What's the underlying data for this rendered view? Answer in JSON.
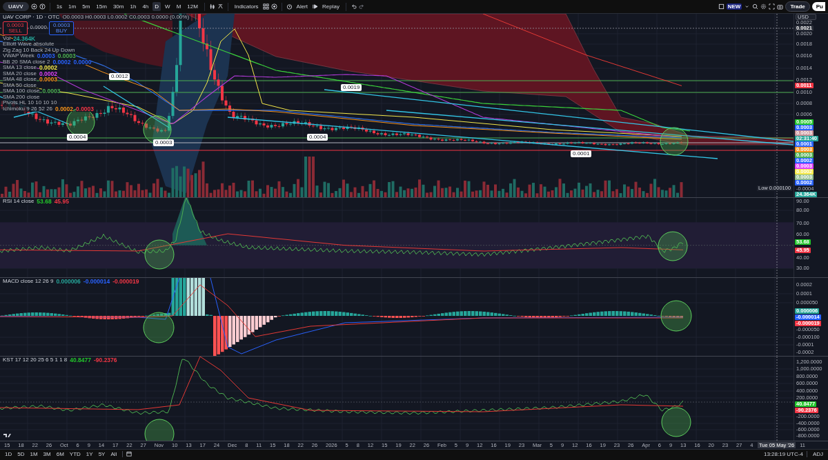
{
  "toolbar": {
    "symbol": "UAVV",
    "intervals": [
      {
        "label": "1s",
        "selected": false
      },
      {
        "label": "1m",
        "selected": false
      },
      {
        "label": "5m",
        "selected": false
      },
      {
        "label": "15m",
        "selected": false
      },
      {
        "label": "30m",
        "selected": false
      },
      {
        "label": "1h",
        "selected": false
      },
      {
        "label": "4h",
        "selected": false
      },
      {
        "label": "D",
        "selected": true
      },
      {
        "label": "W",
        "selected": false
      },
      {
        "label": "M",
        "selected": false
      },
      {
        "label": "12M",
        "selected": false
      }
    ],
    "indicators": "Indicators",
    "alert": "Alert",
    "replay": "Replay",
    "new_badge": "NEW",
    "trade": "Trade",
    "publish": "Pu"
  },
  "panes": [
    {
      "kind": "price",
      "title": "UAV CORP · 1D · OTC",
      "ohlc": "O0.0003 H0.0003 L0.0002 C0.0003 0.0000 (0.00%)",
      "sell": {
        "price": "0.0003",
        "label": "SELL"
      },
      "spread": "0.0000",
      "buy": {
        "price": "0.0003",
        "label": "BUY"
      },
      "legend": [
        {
          "label": "Vol",
          "values": [
            {
              "text": "24.364K",
              "color": "#26a69a"
            }
          ]
        },
        {
          "label": "Elliott Wave absolute"
        },
        {
          "label": "Zig Zag 10 Back 24 Up Down"
        },
        {
          "label": "VWAP Week",
          "values": [
            {
              "text": "0.0003",
              "color": "#2962ff"
            },
            {
              "text": "0.0003",
              "color": "#4caf50"
            }
          ]
        },
        {
          "label": "BB 20 SMA close 2",
          "values": [
            {
              "text": "0.0002",
              "color": "#2962ff"
            },
            {
              "text": "0.0000",
              "color": "#2962ff"
            }
          ]
        },
        {
          "label": "SMA 13 close",
          "values": [
            {
              "text": "0.0002",
              "color": "#f5e94b"
            }
          ]
        },
        {
          "label": "SMA 20 close",
          "values": [
            {
              "text": "0.0002",
              "color": "#e040fb"
            }
          ]
        },
        {
          "label": "SMA 48 close",
          "values": [
            {
              "text": "0.0003",
              "color": "#f7931a"
            }
          ]
        },
        {
          "label": "SMA 50 close"
        },
        {
          "label": "SMA 100 close",
          "values": [
            {
              "text": "0.0003",
              "color": "#4caf50"
            }
          ]
        },
        {
          "label": "SMA 200 close"
        },
        {
          "label": "Pivots HL 10 10 10 10"
        },
        {
          "label": "Ichimoku 9 26 52 26",
          "values": [
            {
              "text": "0.0002",
              "color": "#f7931a"
            },
            {
              "text": "0.0003",
              "color": "#f23645"
            }
          ]
        }
      ],
      "callouts": [
        {
          "text": "0.0012"
        },
        {
          "text": "0.0004"
        },
        {
          "text": "0.0003"
        },
        {
          "text": "0.0004"
        },
        {
          "text": "0.0019"
        },
        {
          "text": "0.0001"
        }
      ],
      "currency": "USD",
      "axis": [
        {
          "kind": "tick",
          "text": "0.0022"
        },
        {
          "kind": "badge",
          "text": "0.0021",
          "color": "#2a2e39"
        },
        {
          "kind": "tick",
          "text": "0.0020"
        },
        {
          "kind": "tick",
          "text": "0.0018"
        },
        {
          "kind": "tick",
          "text": "0.0016"
        },
        {
          "kind": "tick",
          "text": "0.0014"
        },
        {
          "kind": "tick",
          "text": "0.0012"
        },
        {
          "kind": "badge",
          "text": "0.0011",
          "color": "#f23645"
        },
        {
          "kind": "tick",
          "text": "0.0010"
        },
        {
          "kind": "tick",
          "text": "0.0008"
        },
        {
          "kind": "tick",
          "text": "0.0006"
        },
        {
          "kind": "badge",
          "text": "0.0005",
          "color": "#22c52b"
        },
        {
          "kind": "badge",
          "text": "0.0003",
          "color": "#2962ff"
        },
        {
          "kind": "badge",
          "text": "0.0003",
          "color": "#c98f96"
        },
        {
          "kind": "badge",
          "text": "02:31:40",
          "color": "#26a69a"
        },
        {
          "kind": "badge",
          "text": "0.0001",
          "color": "#2962ff"
        },
        {
          "kind": "badge",
          "text": "0.0003",
          "color": "#f7931a"
        },
        {
          "kind": "badge",
          "text": "0.0003",
          "color": "#4caf50"
        },
        {
          "kind": "badge",
          "text": "0.0002",
          "color": "#2962ff"
        },
        {
          "kind": "badge",
          "text": "0.0003",
          "color": "#e040fb"
        },
        {
          "kind": "badge",
          "text": "0.0002",
          "color": "#f5e94b"
        },
        {
          "kind": "badge",
          "text": "0.0003",
          "color": "#8fbc8f"
        },
        {
          "kind": "badge",
          "text": "0.0002",
          "color": "#2962ff"
        },
        {
          "kind": "low",
          "text": "0.000100",
          "label": "Low"
        },
        {
          "kind": "tick",
          "text": "-0.0004"
        },
        {
          "kind": "badge",
          "text": "24.364K",
          "color": "#26a69a"
        }
      ]
    },
    {
      "kind": "rsi",
      "title": "RSI 14 close",
      "values": [
        {
          "text": "53.68",
          "color": "#22c52b"
        },
        {
          "text": "45.95",
          "color": "#f23645"
        }
      ],
      "axis": [
        {
          "kind": "tick",
          "text": "90.00"
        },
        {
          "kind": "tick",
          "text": "80.00"
        },
        {
          "kind": "tick",
          "text": "70.00"
        },
        {
          "kind": "tick",
          "text": "60.00"
        },
        {
          "kind": "badge",
          "text": "53.68",
          "color": "#22c52b"
        },
        {
          "kind": "badge",
          "text": "45.95",
          "color": "#f23645"
        },
        {
          "kind": "tick",
          "text": "40.00"
        },
        {
          "kind": "tick",
          "text": "30.00"
        }
      ]
    },
    {
      "kind": "macd",
      "title": "MACD close 12 26 9",
      "values": [
        {
          "text": "0.000006",
          "color": "#26a69a"
        },
        {
          "text": "-0.000014",
          "color": "#2962ff"
        },
        {
          "text": "-0.000019",
          "color": "#f23645"
        }
      ],
      "axis": [
        {
          "kind": "tick",
          "text": "0.0002"
        },
        {
          "kind": "tick",
          "text": "0.0001"
        },
        {
          "kind": "tick",
          "text": "0.000050"
        },
        {
          "kind": "badge",
          "text": "0.000006",
          "color": "#26a69a"
        },
        {
          "kind": "badge",
          "text": "-0.000014",
          "color": "#2962ff"
        },
        {
          "kind": "badge",
          "text": "-0.000019",
          "color": "#f23645"
        },
        {
          "kind": "tick",
          "text": "-0.000050"
        },
        {
          "kind": "tick",
          "text": "-0.000100"
        },
        {
          "kind": "tick",
          "text": "-0.0001"
        },
        {
          "kind": "tick",
          "text": "-0.0002"
        }
      ]
    },
    {
      "kind": "kst",
      "title": "KST 17 12 20 25 6 5 1 1 8",
      "values": [
        {
          "text": "40.8477",
          "color": "#22c52b"
        },
        {
          "text": "-90.2376",
          "color": "#f23645"
        }
      ],
      "axis": [
        {
          "kind": "tick",
          "text": "1,200.0000"
        },
        {
          "kind": "tick",
          "text": "1,000.0000"
        },
        {
          "kind": "tick",
          "text": "800.0000"
        },
        {
          "kind": "tick",
          "text": "600.0000"
        },
        {
          "kind": "tick",
          "text": "400.0000"
        },
        {
          "kind": "tick",
          "text": "200.0000"
        },
        {
          "kind": "badge",
          "text": "40.8477",
          "color": "#22c52b"
        },
        {
          "kind": "badge",
          "text": "-90.2376",
          "color": "#f23645"
        },
        {
          "kind": "tick",
          "text": "-200.0000"
        },
        {
          "kind": "tick",
          "text": "-400.0000"
        },
        {
          "kind": "tick",
          "text": "-600.0000"
        },
        {
          "kind": "tick",
          "text": "-800.0000"
        }
      ]
    }
  ],
  "time_axis": {
    "labels": [
      "15",
      "18",
      "22",
      "26",
      "Oct",
      "6",
      "9",
      "14",
      "17",
      "22",
      "27",
      "Nov",
      "10",
      "13",
      "17",
      "24",
      "Dec",
      "8",
      "11",
      "15",
      "18",
      "22",
      "26",
      "2026",
      "5",
      "8",
      "12",
      "15",
      "19",
      "22",
      "26",
      "Feb",
      "5",
      "9",
      "12",
      "16",
      "19",
      "23",
      "Mar",
      "5",
      "9",
      "12",
      "16",
      "19",
      "23",
      "26",
      "Apr",
      "6",
      "9",
      "13",
      "16",
      "20",
      "23",
      "27",
      "4"
    ],
    "crosshair": "Tue 05 May '26",
    "after": "11"
  },
  "bottom_bar": {
    "ranges": [
      "1D",
      "5D",
      "1M",
      "3M",
      "6M",
      "YTD",
      "1Y",
      "5Y",
      "All"
    ],
    "clock": "13:28:19 UTC-4",
    "adjust": "ADJ"
  }
}
